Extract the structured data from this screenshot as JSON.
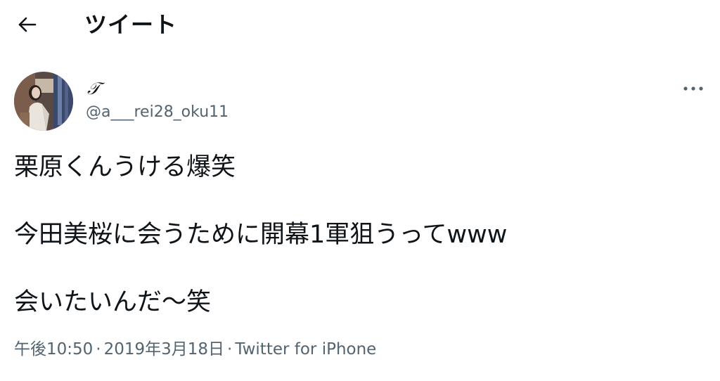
{
  "header": {
    "back_icon": "arrow-left-icon",
    "title": "ツイート"
  },
  "tweet": {
    "avatar_icon": "profile-photo",
    "display_name": "𝒯",
    "handle": "@a___rei28_oku11",
    "more_icon": "more-horizontal-icon",
    "lines": [
      "栗原くんうける爆笑",
      "今田美桜に会うために開幕1軍狙うってwww",
      "会いたいんだ〜笑"
    ],
    "meta": {
      "time": "午後10:50",
      "separator": "·",
      "date": "2019年3月18日",
      "source": "Twitter for iPhone"
    }
  },
  "colors": {
    "text_primary": "#0f1419",
    "text_secondary": "#536471",
    "background": "#ffffff"
  }
}
